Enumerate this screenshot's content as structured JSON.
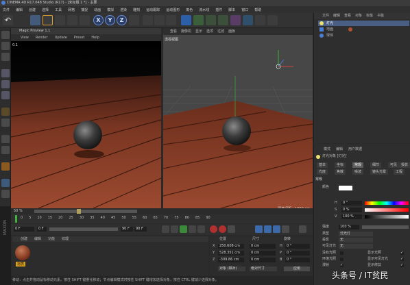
{
  "window": {
    "title": "CINEMA 4D R17.048 Studio (R17) - [未标题 1 *] - 主要"
  },
  "menubar": {
    "items": [
      "文件",
      "编辑",
      "创建",
      "选择",
      "工具",
      "网格",
      "捕捉",
      "动画",
      "模拟",
      "渲染",
      "雕刻",
      "运动跟踪",
      "运动图形",
      "角色",
      "流水线",
      "插件",
      "脚本",
      "窗口",
      "帮助"
    ]
  },
  "toolbar": {
    "axis_x": "X",
    "axis_y": "Y",
    "axis_z": "Z"
  },
  "magic_preview": {
    "title": "Magic Preview 1.1",
    "menu": [
      "View",
      "Render",
      "Update",
      "Preset",
      "Help"
    ],
    "frame": "0.1",
    "zoom": "50 %"
  },
  "viewport": {
    "menu": [
      "查看",
      "摄像机",
      "显示",
      "选项",
      "过滤",
      "面板"
    ],
    "camera_label": "透视视图",
    "grid_label": "网格间距 : 1000 cm"
  },
  "timeline": {
    "ticks": [
      "0",
      "5",
      "10",
      "15",
      "20",
      "25",
      "30",
      "35",
      "40",
      "45",
      "50",
      "55",
      "60",
      "65",
      "70",
      "75",
      "80",
      "85",
      "90"
    ],
    "current": "0 F",
    "start": "0 F",
    "end": "90 F",
    "end2": "90 F"
  },
  "material_manager": {
    "menu": [
      "创建",
      "编辑",
      "功能",
      "纹理"
    ],
    "material_name": "材质"
  },
  "coordinates": {
    "headers": [
      "位置",
      "尺寸",
      "旋转"
    ],
    "rows": [
      {
        "axis": "X",
        "pos": "250.608 cm",
        "size": "0 cm",
        "rot_axis": "H",
        "rot": "0 °"
      },
      {
        "axis": "Y",
        "pos": "528.351 cm",
        "size": "0 cm",
        "rot_axis": "P",
        "rot": "0 °"
      },
      {
        "axis": "Z",
        "pos": "-309.86 cm",
        "size": "0 cm",
        "rot_axis": "B",
        "rot": "0 °"
      }
    ],
    "mode1": "对象 (相对)",
    "mode2": "绝对尺寸",
    "apply": "应用"
  },
  "status": "移动：点击并拖动鼠标移动元素。按住 SHIFT 键量化移动；节点编辑模式时按住 SHIFT 键增加选择对象；按住 CTRL 键减少选择对象。",
  "object_manager": {
    "menu": [
      "文件",
      "编辑",
      "查看",
      "对象",
      "标签",
      "书签"
    ],
    "objects": [
      {
        "name": "灯光",
        "selected": true
      },
      {
        "name": "地面",
        "selected": false
      },
      {
        "name": "球体",
        "selected": false
      }
    ]
  },
  "attributes": {
    "menu": [
      "模式",
      "编辑",
      "用户数据"
    ],
    "object_label": "灯光对象 [灯光]",
    "tabs_row1": [
      "基本",
      "坐标",
      "常规",
      "细节",
      "可见",
      "投影"
    ],
    "tabs_row2": [
      "光度",
      "焦散",
      "噪波",
      "镜头光晕",
      "工程"
    ],
    "active_tab": "常规",
    "section": "常规",
    "color_label": "颜色",
    "channels": [
      {
        "key": "H",
        "value": "0 °"
      },
      {
        "key": "S",
        "value": "0 %"
      },
      {
        "key": "V",
        "value": "100 %"
      }
    ],
    "intensity_label": "强度",
    "intensity": "100 %",
    "type_label": "类型",
    "type": "泛光灯",
    "shadow_label": "投影",
    "shadow": "无",
    "visible_light_label": "可见灯光",
    "visible_light": "无",
    "no_illumination_label": "没有光照",
    "show_illumination_label": "显示光照",
    "ambient_label": "环境光照",
    "show_visible_label": "显示可见灯光",
    "diffuse_label": "漫射",
    "show_clipping_label": "显示修剪",
    "colors": {
      "accent": "#4a7fd4",
      "selected_row": "#4a5d82",
      "floor": "#8b3a23"
    }
  },
  "watermark": "头条号 / IT贫民"
}
